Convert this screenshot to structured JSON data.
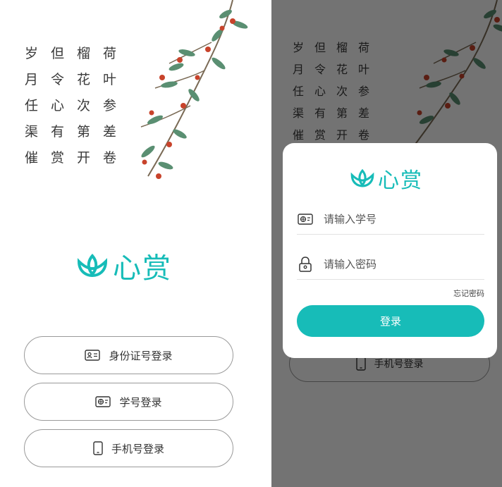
{
  "poem": [
    [
      "岁",
      "但",
      "榴",
      "荷"
    ],
    [
      "月",
      "令",
      "花",
      "叶"
    ],
    [
      "任",
      "心",
      "次",
      "参"
    ],
    [
      "渠",
      "有",
      "第",
      "差"
    ],
    [
      "催",
      "赏",
      "开",
      "卷"
    ]
  ],
  "brand": {
    "name": "心赏",
    "color": "#17bcb8",
    "logo_icon": "lotus-icon"
  },
  "login_options": {
    "id_card": {
      "label": "身份证号登录",
      "icon": "id-card-icon"
    },
    "student_id": {
      "label": "学号登录",
      "icon": "student-card-icon"
    },
    "phone": {
      "label": "手机号登录",
      "icon": "phone-icon"
    }
  },
  "modal": {
    "student_id_placeholder": "请输入学号",
    "password_placeholder": "请输入密码",
    "forgot_password": "忘记密码",
    "submit_label": "登录"
  }
}
